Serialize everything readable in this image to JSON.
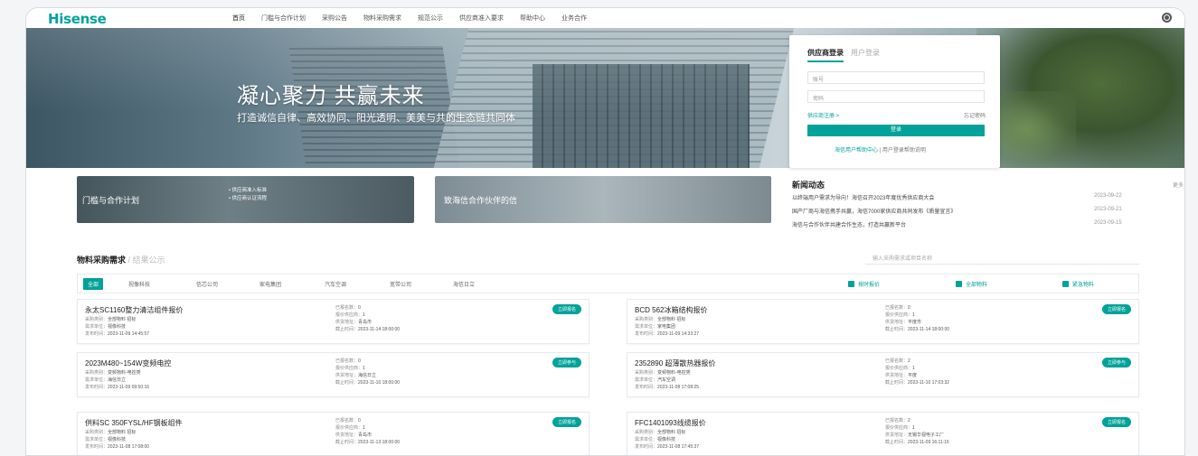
{
  "brand": "Hisense",
  "nav": [
    {
      "label": "首页"
    },
    {
      "label": "门槛与合作计划"
    },
    {
      "label": "采购公告"
    },
    {
      "label": "物料采购需求"
    },
    {
      "label": "规范公示"
    },
    {
      "label": "供应商准入要求"
    },
    {
      "label": "帮助中心"
    },
    {
      "label": "业务合作"
    }
  ],
  "hero": {
    "title": "凝心聚力  共赢未来",
    "subtitle": "打造诚信自律、高效协同、阳光透明、美美与共的生态链共同体"
  },
  "login": {
    "tab_active": "供应商登录",
    "tab_inactive": "用户登录",
    "account_placeholder": "账号",
    "password_placeholder": "密码",
    "register": "供应商注册 >",
    "forgot": "忘记密码",
    "submit": "登录",
    "footer_link": "海信用户帮助中心",
    "footer_sep": " | ",
    "footer_text": "用户登录帮助说明"
  },
  "banners": {
    "b1_title": "门槛与合作计划",
    "b1_items": [
      "供应商准入标准",
      "供应商认证流程"
    ],
    "b2_title": "致海信合作伙伴的信"
  },
  "news": {
    "title": "新闻动态",
    "more": "更多",
    "items": [
      {
        "text": "以终端用户需求为导向！海信召开2023年度优秀供应商大会",
        "date": "2023-09-22"
      },
      {
        "text": "国产厂商与海信携手共赢，海信7000家供应商共同发布《质量宣言》",
        "date": "2023-09-21"
      },
      {
        "text": "海信与合作伙伴共建合作生态，打造共赢新平台",
        "date": "2023-09-15"
      }
    ]
  },
  "procurement": {
    "title": "物料采购需求",
    "divider": " / ",
    "subtitle": "结果公示",
    "search_placeholder": "输入采购需求或项目名称",
    "filters": [
      "全部",
      "视像科技",
      "信芯公司",
      "家电集团",
      "汽车空调",
      "宽带公司",
      "海信日立"
    ],
    "checks": [
      "按时报价",
      "全部物料",
      "紧急物料"
    ]
  },
  "cards": [
    {
      "title": "永太SC1160整力清洁组件报价",
      "button": "立即报名",
      "left": [
        [
          "采购类别：",
          "全部物料 招标"
        ],
        [
          "需求单位：",
          "视像科技"
        ],
        [
          "发布时间：",
          "2023-11-09 14:45:57"
        ]
      ],
      "right": [
        [
          "已报名数：",
          "0"
        ],
        [
          "报价供应商：",
          "1"
        ],
        [
          "供货地址：",
          "青岛市"
        ],
        [
          "截止时间：",
          "2023-11-14 18:00:00"
        ]
      ]
    },
    {
      "title": "BCD 562冰箱结构报价",
      "button": "立即报名",
      "left": [
        [
          "采购类别：",
          "全部物料 招标"
        ],
        [
          "需求单位：",
          "家电集团"
        ],
        [
          "发布时间：",
          "2023-11-09 14:33:27"
        ]
      ],
      "right": [
        [
          "已报名数：",
          "0"
        ],
        [
          "报价供应商：",
          "1"
        ],
        [
          "供货地址：",
          "平度市"
        ],
        [
          "截止时间：",
          "2023-11-14 18:00:00"
        ]
      ]
    },
    {
      "title": "2023M480~154W变频电控",
      "button": "立即参与",
      "left": [
        [
          "采购类别：",
          "变频物料-电控类"
        ],
        [
          "需求单位：",
          "海信日立"
        ],
        [
          "发布时间：",
          "2023-11-09 09:50:16"
        ]
      ],
      "right": [
        [
          "已报名数：",
          "0"
        ],
        [
          "报价供应商：",
          "1"
        ],
        [
          "供货地址：",
          "海信日立"
        ],
        [
          "截止时间：",
          "2023-11-10 18:00:00"
        ]
      ]
    },
    {
      "title": "2352890 超薄散热器报价",
      "button": "立即参与",
      "left": [
        [
          "采购类别：",
          "变频物料-电控类"
        ],
        [
          "需求单位：",
          "汽车空调"
        ],
        [
          "发布时间：",
          "2023-11-08 17:08:25"
        ]
      ],
      "right": [
        [
          "已报名数：",
          "2"
        ],
        [
          "报价供应商：",
          "1"
        ],
        [
          "供货地址：",
          "平度"
        ],
        [
          "截止时间：",
          "2023-11-10 17:03:32"
        ]
      ]
    },
    {
      "title": "供料SC 350FYSL/HF钢板组件",
      "button": "立即报名",
      "left": [
        [
          "采购类别：",
          "全部物料 招标"
        ],
        [
          "需求单位：",
          "视像科技"
        ],
        [
          "发布时间：",
          "2023-11-08 17:08:00"
        ]
      ],
      "right": [
        [
          "已报名数：",
          "0"
        ],
        [
          "报价供应商：",
          "1"
        ],
        [
          "供货地址：",
          "青岛市"
        ],
        [
          "截止时间：",
          "2023-11-13 18:00:00"
        ]
      ]
    },
    {
      "title": "FFC1401093线缆报价",
      "button": "立即报名",
      "left": [
        [
          "采购类别：",
          "全部物料 招标"
        ],
        [
          "需求单位：",
          "视像科技"
        ],
        [
          "发布时间：",
          "2023-11-08 17:45:37"
        ]
      ],
      "right": [
        [
          "已报名数：",
          "2"
        ],
        [
          "报价供应商：",
          "1"
        ],
        [
          "供货地址：",
          "无锡华视电子工厂"
        ],
        [
          "截止时间：",
          "2023-11-09 16:11:16"
        ]
      ]
    }
  ],
  "colors": {
    "accent": "#00a29a"
  }
}
